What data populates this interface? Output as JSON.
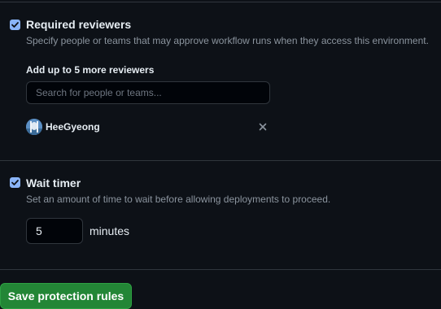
{
  "required_reviewers": {
    "checked": true,
    "title": "Required reviewers",
    "description": "Specify people or teams that may approve workflow runs when they access this environment.",
    "add_label": "Add up to 5 more reviewers",
    "search_placeholder": "Search for people or teams...",
    "reviewers": [
      {
        "name": "HeeGyeong",
        "avatar_icon": "user-avatar"
      }
    ]
  },
  "wait_timer": {
    "checked": true,
    "title": "Wait timer",
    "description": "Set an amount of time to wait before allowing deployments to proceed.",
    "value": "5",
    "unit": "minutes"
  },
  "actions": {
    "save_label": "Save protection rules"
  },
  "colors": {
    "background": "#0d1117",
    "checkbox": "#8ab4f8",
    "save_button": "#238636",
    "muted_text": "#8b949e"
  }
}
